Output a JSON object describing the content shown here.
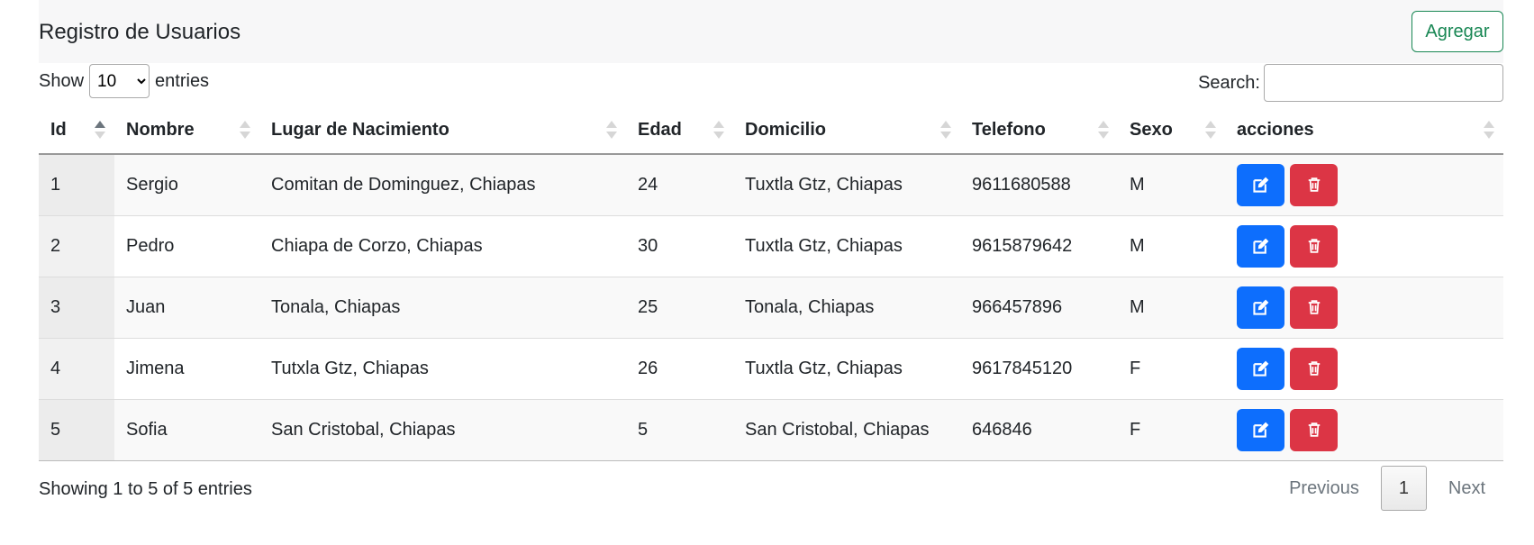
{
  "header": {
    "title": "Registro de Usuarios",
    "add_label": "Agregar"
  },
  "length": {
    "show_label": "Show",
    "selected": "10",
    "entries_label": "entries"
  },
  "search": {
    "label": "Search:",
    "value": ""
  },
  "table": {
    "columns": [
      "Id",
      "Nombre",
      "Lugar de Nacimiento",
      "Edad",
      "Domicilio",
      "Telefono",
      "Sexo",
      "acciones"
    ],
    "rows": [
      [
        "1",
        "Sergio",
        "Comitan de Dominguez, Chiapas",
        "24",
        "Tuxtla Gtz, Chiapas",
        "9611680588",
        "M"
      ],
      [
        "2",
        "Pedro",
        "Chiapa de Corzo, Chiapas",
        "30",
        "Tuxtla Gtz, Chiapas",
        "9615879642",
        "M"
      ],
      [
        "3",
        "Juan",
        "Tonala, Chiapas",
        "25",
        "Tonala, Chiapas",
        "966457896",
        "M"
      ],
      [
        "4",
        "Jimena",
        "Tutxla Gtz, Chiapas",
        "26",
        "Tuxtla Gtz, Chiapas",
        "9617845120",
        "F"
      ],
      [
        "5",
        "Sofia",
        "San Cristobal, Chiapas",
        "5",
        "San Cristobal, Chiapas",
        "646846",
        "F"
      ]
    ]
  },
  "footer": {
    "info": "Showing 1 to 5 of 5 entries",
    "previous": "Previous",
    "page": "1",
    "next": "Next"
  },
  "icons": {
    "edit": "edit-icon",
    "delete": "trash-icon"
  },
  "colors": {
    "primary": "#0d6efd",
    "danger": "#dc3545",
    "success": "#198754"
  }
}
